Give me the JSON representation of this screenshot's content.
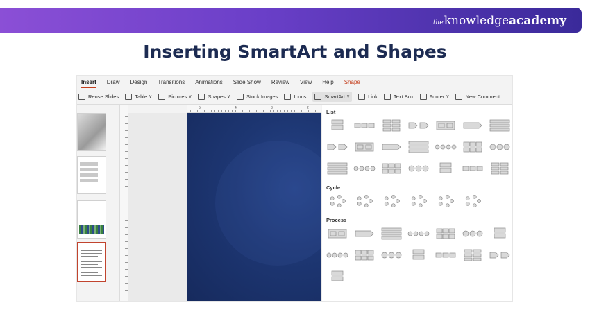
{
  "brand": {
    "the": "the",
    "knowledge": "knowledge",
    "academy": "academy"
  },
  "headline": "Inserting SmartArt and Shapes",
  "tabs": [
    {
      "label": "Insert",
      "active": true
    },
    {
      "label": "Draw"
    },
    {
      "label": "Design"
    },
    {
      "label": "Transitions"
    },
    {
      "label": "Animations"
    },
    {
      "label": "Slide Show"
    },
    {
      "label": "Review"
    },
    {
      "label": "View"
    },
    {
      "label": "Help"
    },
    {
      "label": "Shape",
      "contextual": true
    }
  ],
  "ribbon": [
    {
      "label": "Reuse Slides",
      "icon": "reuse-slides-icon"
    },
    {
      "label": "Table",
      "icon": "table-icon",
      "dropdown": true
    },
    {
      "label": "Pictures",
      "icon": "pictures-icon",
      "dropdown": true
    },
    {
      "label": "Shapes",
      "icon": "shapes-icon",
      "dropdown": true
    },
    {
      "label": "Stock Images",
      "icon": "stock-images-icon"
    },
    {
      "label": "Icons",
      "icon": "icons-icon"
    },
    {
      "label": "SmartArt",
      "icon": "smartart-icon",
      "dropdown": true,
      "pressed": true
    },
    {
      "label": "Link",
      "icon": "link-icon"
    },
    {
      "label": "Text Box",
      "icon": "text-box-icon"
    },
    {
      "label": "Footer",
      "icon": "footer-icon",
      "dropdown": true
    },
    {
      "label": "New Comment",
      "icon": "new-comment-icon"
    }
  ],
  "ruler_numbers": [
    "5",
    "4",
    "3",
    "2"
  ],
  "gallery": {
    "sections": [
      {
        "name": "List",
        "rows": 3,
        "cols": 7,
        "last_row_count": 7
      },
      {
        "name": "Cycle",
        "rows": 1,
        "cols": 6,
        "last_row_count": 6
      },
      {
        "name": "Process",
        "rows": 3,
        "cols": 7,
        "last_row_count": 1
      }
    ]
  },
  "colors": {
    "banner_start": "#8b4fd6",
    "banner_end": "#3a2a9a",
    "headline": "#1c2b52",
    "active_tab_underline": "#c43e1c",
    "slide_blue": "#1d3672",
    "selected_thumb_border": "#c1442e"
  }
}
